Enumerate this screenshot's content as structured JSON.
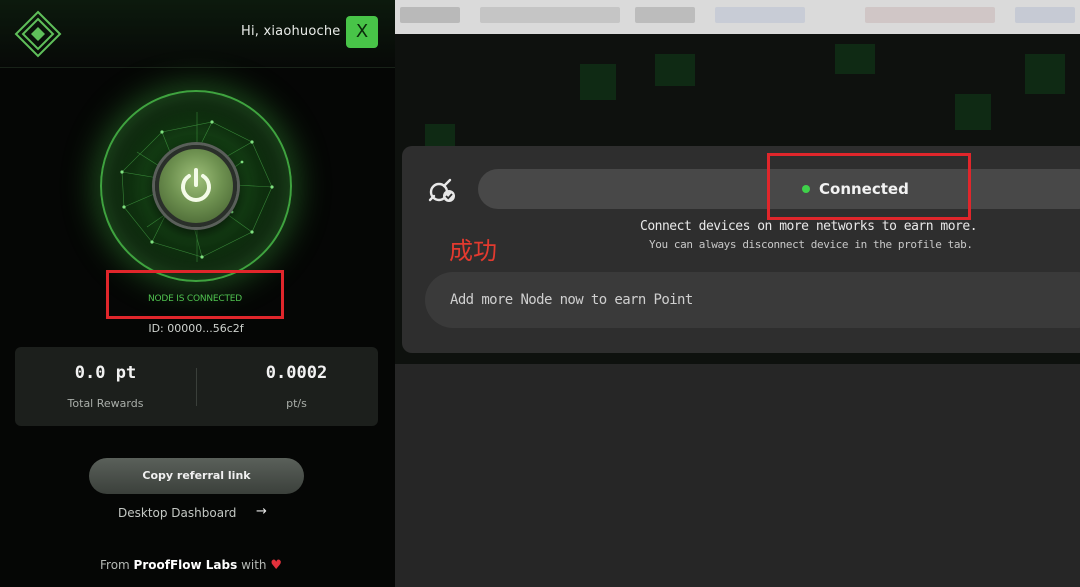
{
  "extension": {
    "greeting": "Hi, xiaohuoche",
    "avatar_letter": "X",
    "node_status": "NODE IS CONNECTED",
    "node_id": "ID: 00000...56c2f",
    "stats": [
      {
        "value": "0.0 pt",
        "label": "Total Rewards"
      },
      {
        "value": "0.0002",
        "label": "pt/s"
      }
    ],
    "referral_label": "Copy referral link",
    "desktop_link": "Desktop Dashboard",
    "desktop_arrow": "→",
    "footer_prefix": "From ",
    "footer_brand": "ProofFlow Labs",
    "footer_suffix": " with ",
    "footer_heart": "♥"
  },
  "dashboard": {
    "status": "Connected",
    "connect_msg": "Connect devices on more networks to earn more.",
    "disconnect_msg": "You can always disconnect device in the profile tab.",
    "add_node": "Add more Node now to earn Point",
    "annotation": "成功"
  },
  "colors": {
    "accent_green": "#48c448",
    "connected_dot": "#3fd14a",
    "highlight_red": "#e0262b"
  }
}
